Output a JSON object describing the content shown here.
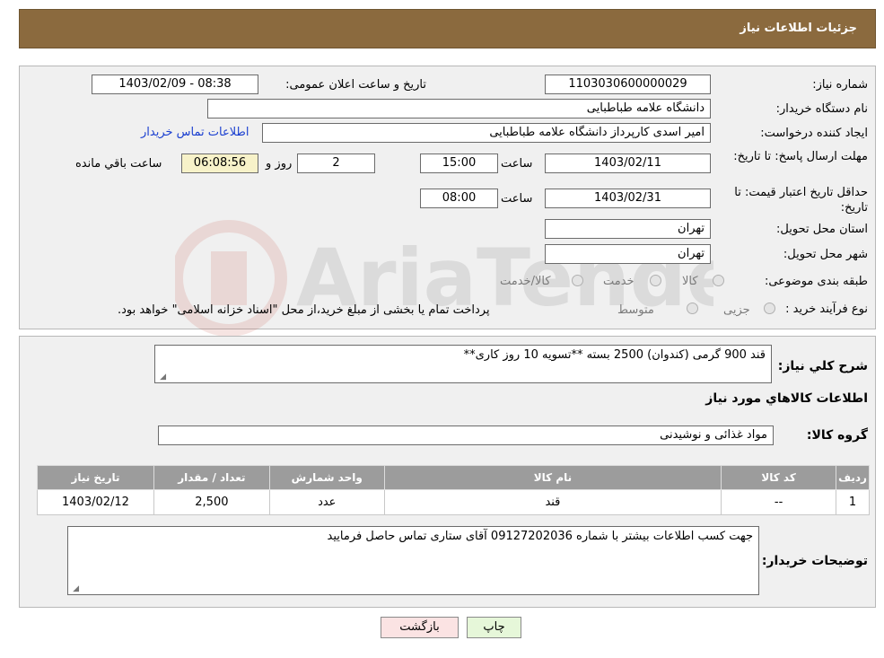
{
  "header": {
    "title": "جزئیات اطلاعات نیاز"
  },
  "form": {
    "need_number": {
      "label": "شماره نیاز:",
      "value": "1103030600000029"
    },
    "announce": {
      "label": "تاریخ و ساعت اعلان عمومی:",
      "value": "1403/02/09 - 08:38"
    },
    "buyer_org": {
      "label": "نام دستگاه خریدار:",
      "value": "دانشگاه علامه طباطبایی"
    },
    "requester": {
      "label": "ایجاد کننده درخواست:",
      "value": "امیر اسدی کارپرداز دانشگاه علامه طباطبایی",
      "link": "اطلاعات تماس خریدار"
    },
    "deadline": {
      "label": "مهلت ارسال پاسخ: تا تاریخ:",
      "date": "1403/02/11",
      "time_label": "ساعت",
      "time": "15:00",
      "days": "2",
      "days_label": "روز و",
      "remaining": "06:08:56",
      "remaining_label": "ساعت باقي مانده"
    },
    "validity": {
      "label": "حداقل تاریخ اعتبار قیمت: تا تاریخ:",
      "date": "1403/02/31",
      "time_label": "ساعت",
      "time": "08:00"
    },
    "province": {
      "label": "استان محل تحویل:",
      "value": "تهران"
    },
    "city": {
      "label": "شهر محل تحویل:",
      "value": "تهران"
    },
    "category": {
      "label": "طبقه بندی موضوعی:",
      "options": [
        "کالا",
        "خدمت",
        "کالا/خدمت"
      ]
    },
    "process": {
      "label": "نوع فرآیند خرید :",
      "options": [
        "جزیی",
        "متوسط"
      ],
      "note": "پرداخت تمام یا بخشی از مبلغ خرید،از محل \"اسناد خزانه اسلامی\" خواهد بود."
    }
  },
  "details": {
    "desc_label": "شرح کلي نياز:",
    "desc_value": "قند 900 گرمی (کندوان) 2500 بسته  **تسویه 10 روز کاری**",
    "goods_info_title": "اطلاعات کالاهاي مورد نياز",
    "group_label": "گروه کالا:",
    "group_value": "مواد غذائی و نوشیدنی",
    "table": {
      "headers": [
        "رديف",
        "کد کالا",
        "نام کالا",
        "واحد شمارش",
        "تعداد / مقدار",
        "تاريخ نياز"
      ],
      "rows": [
        [
          "1",
          "--",
          "قند",
          "عدد",
          "2,500",
          "1403/02/12"
        ]
      ]
    },
    "buyer_notes_label": "توضیحات خریدار:",
    "buyer_notes_value": "جهت کسب اطلاعات بیشتر با شماره 09127202036 آقای ستاری تماس حاصل فرمایید"
  },
  "buttons": {
    "print": "چاپ",
    "back": "بازگشت"
  },
  "watermark": {
    "text": "AriaTender.neT"
  },
  "colors": {
    "titlebar": "#8B6A3E",
    "table_header": "#9c9c9c",
    "back_button": "#fbe3e3",
    "print_button": "#e6f7d9",
    "link": "#1a3fd0"
  }
}
